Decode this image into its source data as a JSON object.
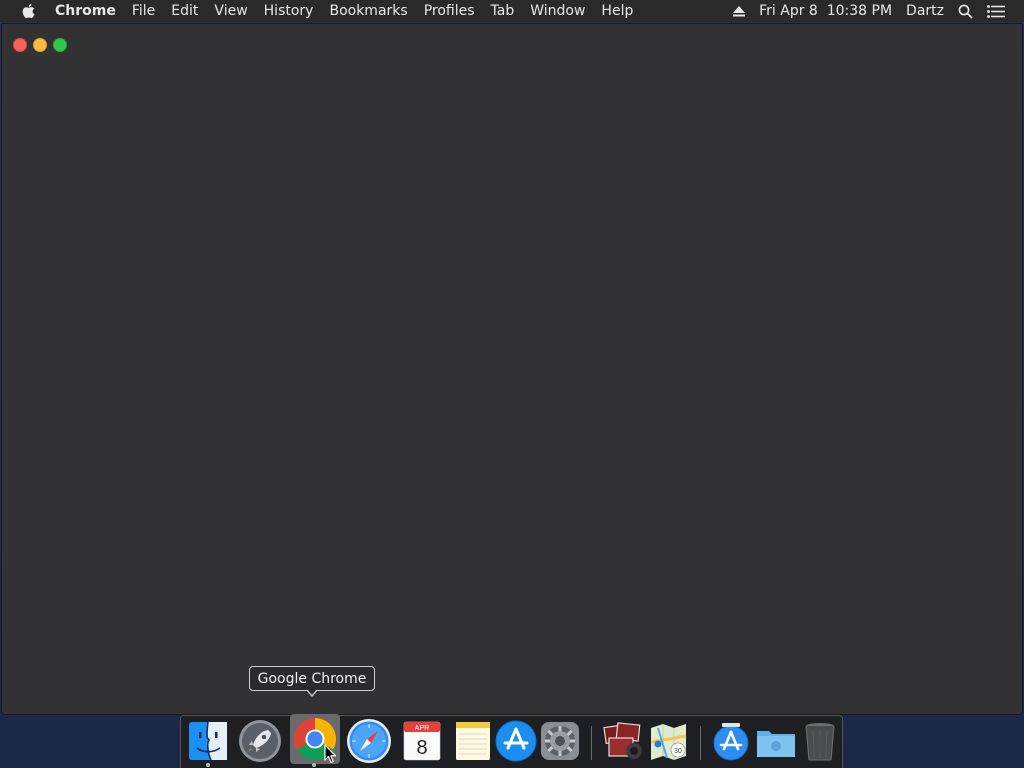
{
  "menubar": {
    "apple_icon": "apple-logo-icon",
    "app_name": "Chrome",
    "menus": [
      "File",
      "Edit",
      "View",
      "History",
      "Bookmarks",
      "Profiles",
      "Tab",
      "Window",
      "Help"
    ],
    "status": {
      "eject_icon": "eject-icon",
      "datetime": "Fri Apr 8  10:38 PM",
      "user": "Dartz",
      "spotlight_icon": "spotlight-search-icon",
      "notification_icon": "notification-center-icon"
    }
  },
  "window": {
    "buttons": [
      "close",
      "minimize",
      "zoom"
    ],
    "background_color": "#323234"
  },
  "tooltip": {
    "text": "Google Chrome"
  },
  "dock": {
    "items": [
      {
        "name": "Finder",
        "icon": "finder-icon",
        "running": true
      },
      {
        "name": "Launchpad",
        "icon": "launchpad-rocket-icon",
        "running": false
      },
      {
        "name": "Google Chrome",
        "icon": "chrome-icon",
        "running": true
      },
      {
        "name": "Safari",
        "icon": "safari-compass-icon",
        "running": false
      },
      {
        "name": "Calendar",
        "icon": "calendar-icon",
        "running": false,
        "month": "APR",
        "day": "8"
      },
      {
        "name": "Notes",
        "icon": "notes-icon",
        "running": false
      },
      {
        "name": "App Store",
        "icon": "app-store-icon",
        "running": false
      },
      {
        "name": "System Preferences",
        "icon": "system-preferences-gear-icon",
        "running": false
      },
      {
        "name": "Photo Booth",
        "icon": "photo-booth-icon",
        "running": false
      },
      {
        "name": "Maps",
        "icon": "maps-icon",
        "running": false
      },
      {
        "name": "Downloads",
        "icon": "downloads-stack-icon",
        "running": false
      },
      {
        "name": "Documents",
        "icon": "folder-icon",
        "running": false
      },
      {
        "name": "Trash",
        "icon": "trash-icon",
        "running": false
      }
    ]
  },
  "colors": {
    "menubar_bg": "#2a2a2b",
    "traffic_close": "#fc605c",
    "traffic_minimize": "#fdbc40",
    "traffic_zoom": "#34c84a"
  }
}
